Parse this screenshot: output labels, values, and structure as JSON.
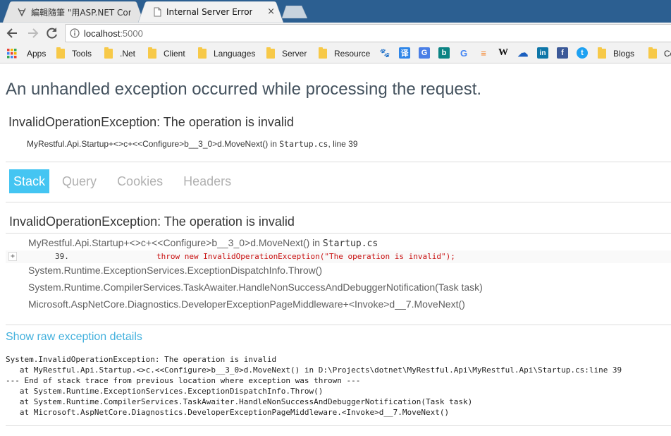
{
  "browser": {
    "tabs": [
      {
        "title": "編輯隨筆 \"用ASP.NET Cor",
        "active": false
      },
      {
        "title": "Internal Server Error",
        "active": true
      }
    ],
    "close_glyph": "×",
    "url_host": "localhost",
    "url_port": ":5000",
    "bookmarks": [
      {
        "label": "Apps",
        "kind": "apps"
      },
      {
        "label": "Tools",
        "kind": "folder"
      },
      {
        "label": ".Net",
        "kind": "folder"
      },
      {
        "label": "Client",
        "kind": "folder"
      },
      {
        "label": "Languages",
        "kind": "folder"
      },
      {
        "label": "Server",
        "kind": "folder"
      },
      {
        "label": "Resource",
        "kind": "folder"
      },
      {
        "label": "Blogs",
        "kind": "folder"
      },
      {
        "label": "Co",
        "kind": "folder"
      }
    ],
    "bookmark_icons": [
      {
        "name": "baidu-paw-icon",
        "glyph": "🐾",
        "color": "#2f6fe0"
      },
      {
        "name": "translate-icon",
        "glyph": "译",
        "color": "#2f86e8"
      },
      {
        "name": "google-translate-icon",
        "glyph": "G",
        "color": "#4a7fe6"
      },
      {
        "name": "bing-icon",
        "glyph": "b",
        "color": "#0c8484"
      },
      {
        "name": "google-icon",
        "glyph": "G",
        "color": "#ffffff"
      },
      {
        "name": "stackoverflow-icon",
        "glyph": "≡",
        "color": "#f48024"
      },
      {
        "name": "wikipedia-icon",
        "glyph": "W",
        "color": "#ffffff"
      },
      {
        "name": "onedrive-icon",
        "glyph": "☁",
        "color": "#ffffff"
      },
      {
        "name": "linkedin-icon",
        "glyph": "in",
        "color": "#0e76a8"
      },
      {
        "name": "facebook-icon",
        "glyph": "f",
        "color": "#3b5998"
      },
      {
        "name": "twitter-icon",
        "glyph": "t",
        "color": "#ffffff"
      }
    ]
  },
  "page": {
    "heading": "An unhandled exception occurred while processing the request.",
    "exception_title": "InvalidOperationException: The operation is invalid",
    "location_method": "MyRestful.Api.Startup+<>c+<<Configure>b__3_0>d.MoveNext() in ",
    "location_file": "Startup.cs",
    "location_line": ", line 39",
    "tabs": [
      "Stack",
      "Query",
      "Cookies",
      "Headers"
    ],
    "selected_tab": "Stack",
    "stack_title": "InvalidOperationException: The operation is invalid",
    "frames": [
      {
        "method": "MyRestful.Api.Startup+<>c+<<Configure>b__3_0>d.MoveNext() in ",
        "file": "Startup.cs"
      },
      {
        "method": "System.Runtime.ExceptionServices.ExceptionDispatchInfo.Throw()"
      },
      {
        "method": "System.Runtime.CompilerServices.TaskAwaiter.HandleNonSuccessAndDebuggerNotification(Task task)"
      },
      {
        "method": "Microsoft.AspNetCore.Diagnostics.DeveloperExceptionPageMiddleware+<Invoke>d__7.MoveNext()"
      }
    ],
    "source_expander": "+",
    "source_line_number": "39.",
    "source_line_code": "throw new InvalidOperationException(\"The operation is invalid\");",
    "raw_link": "Show raw exception details",
    "raw_text": "System.InvalidOperationException: The operation is invalid\n   at MyRestful.Api.Startup.<>c.<<Configure>b__3_0>d.MoveNext() in D:\\Projects\\dotnet\\MyRestful.Api\\MyRestful.Api\\Startup.cs:line 39\n--- End of stack trace from previous location where exception was thrown ---\n   at System.Runtime.ExceptionServices.ExceptionDispatchInfo.Throw()\n   at System.Runtime.CompilerServices.TaskAwaiter.HandleNonSuccessAndDebuggerNotification(Task task)\n   at Microsoft.AspNetCore.Diagnostics.DeveloperExceptionPageMiddleware.<Invoke>d__7.MoveNext()"
  },
  "colors": {
    "tab_selected": "#44c5f2",
    "link": "#44b1dd",
    "error_code": "#c81010"
  }
}
